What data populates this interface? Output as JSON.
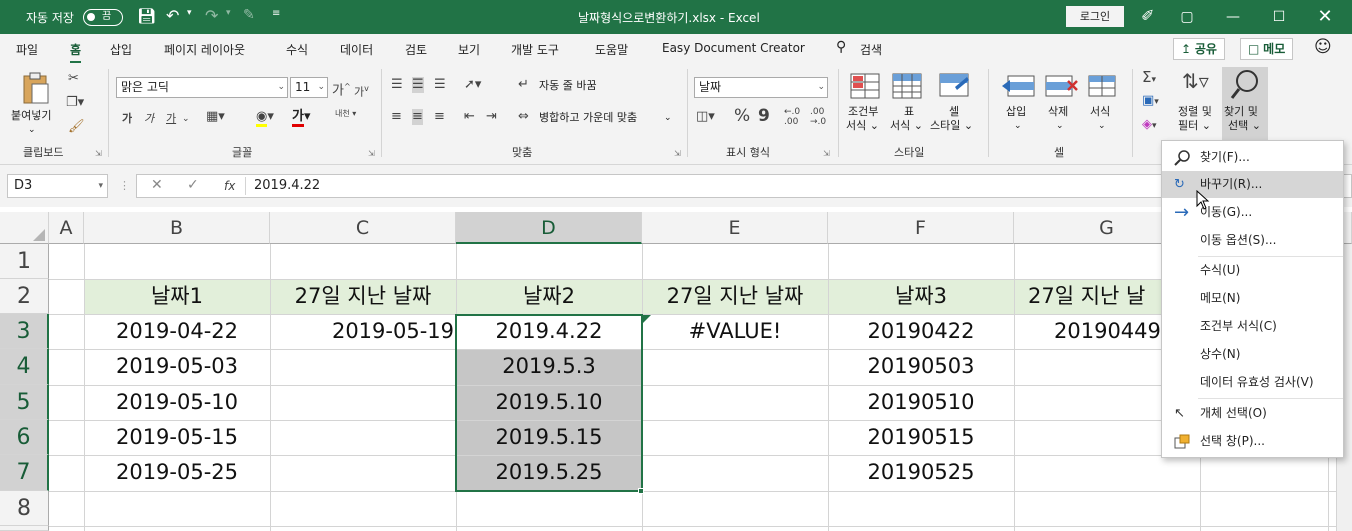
{
  "titlebar": {
    "autosave_label": "자동 저장",
    "autosave_state": "끔",
    "filename": "날짜형식으로변환하기.xlsx",
    "app": "Excel",
    "login": "로그인"
  },
  "tabs": [
    "파일",
    "홈",
    "삽입",
    "페이지 레이아웃",
    "수식",
    "데이터",
    "검토",
    "보기",
    "개발 도구",
    "도움말",
    "Easy Document Creator",
    "검색"
  ],
  "active_tab": "홈",
  "share_label": "공유",
  "comments_label": "메모",
  "ribbon": {
    "clipboard": {
      "label": "클립보드",
      "paste": "붙여넣기"
    },
    "font": {
      "label": "글꼴",
      "name": "맑은 고딕",
      "size": "11",
      "bold": "가",
      "italic": "가",
      "underline": "가",
      "grow": "가",
      "shrink": "가",
      "color_letter": "가",
      "phonetic": "내천"
    },
    "alignment": {
      "label": "맞춤",
      "wrap": "자동 줄 바꿈",
      "merge": "병합하고 가운데 맞춤"
    },
    "number": {
      "label": "표시 형식",
      "format": "날짜",
      "percent": "%",
      "comma": "9"
    },
    "styles": {
      "label": "스타일",
      "cond": [
        "조건부",
        "서식"
      ],
      "table": [
        "표",
        "서식"
      ],
      "cell": [
        "셀",
        "스타일"
      ]
    },
    "cells": {
      "label": "셀",
      "insert": "삽입",
      "delete": "삭제",
      "format": "서식"
    },
    "editing": {
      "sort": [
        "정렬 및",
        "필터"
      ],
      "find": [
        "찾기 및",
        "선택"
      ]
    }
  },
  "formula_bar": {
    "name_box": "D3",
    "value": "2019.4.22",
    "fx": "fx"
  },
  "columns": [
    "A",
    "B",
    "C",
    "D",
    "E",
    "F",
    "G"
  ],
  "selected_column": "D",
  "rows": [
    "1",
    "2",
    "3",
    "4",
    "5",
    "6",
    "7",
    "8"
  ],
  "selected_rows": [
    "3",
    "4",
    "5",
    "6",
    "7"
  ],
  "cells": {
    "B2": "날짜1",
    "C2": "27일 지난 날짜",
    "D2": "날짜2",
    "E2": "27일 지난 날짜",
    "F2": "날짜3",
    "G2": "27일 지난 날",
    "B3": "2019-04-22",
    "C3": "2019-05-19",
    "D3": "2019.4.22",
    "E3": "#VALUE!",
    "F3": "20190422",
    "G3": "20190449",
    "B4": "2019-05-03",
    "D4": "2019.5.3",
    "F4": "20190503",
    "B5": "2019-05-10",
    "D5": "2019.5.10",
    "F5": "20190510",
    "B6": "2019-05-15",
    "D6": "2019.5.15",
    "F6": "20190515",
    "B7": "2019-05-25",
    "D7": "2019.5.25",
    "F7": "20190525"
  },
  "colors": {
    "brand": "#217346",
    "header_fill": "#e2efda",
    "selection": "#c6c6c6"
  },
  "find_menu": {
    "items": [
      {
        "label": "찾기(F)...",
        "icon": "search-icon"
      },
      {
        "label": "바꾸기(R)...",
        "icon": "replace-icon"
      },
      {
        "label": "이동(G)...",
        "icon": "arrow-right-icon"
      },
      {
        "label": "이동 옵션(S)..."
      },
      {
        "label": "수식(U)"
      },
      {
        "label": "메모(N)"
      },
      {
        "label": "조건부 서식(C)"
      },
      {
        "label": "상수(N)"
      },
      {
        "label": "데이터 유효성 검사(V)"
      },
      {
        "label": "개체 선택(O)",
        "icon": "cursor-icon"
      },
      {
        "label": "선택 창(P)...",
        "icon": "selection-pane-icon"
      }
    ],
    "highlighted": "바꾸기(R)..."
  }
}
